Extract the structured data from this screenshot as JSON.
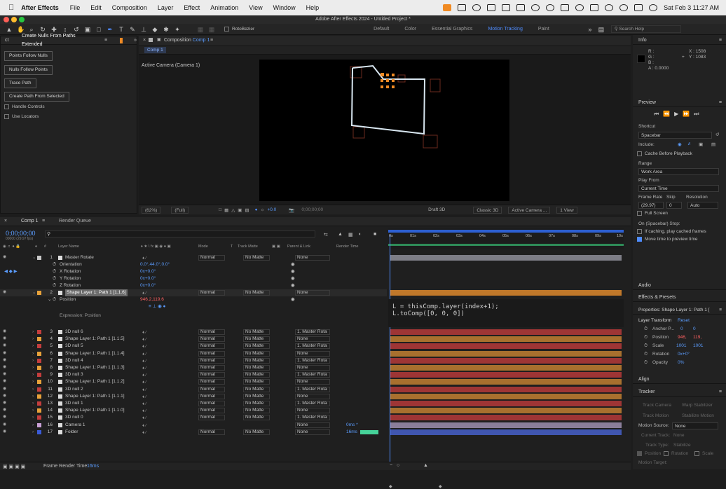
{
  "menubar": {
    "app_name": "After Effects",
    "menus": [
      "File",
      "Edit",
      "Composition",
      "Layer",
      "Effect",
      "Animation",
      "View",
      "Window",
      "Help"
    ],
    "clock": "Sat Feb 3  11:27 AM"
  },
  "window_title": "Adobe After Effects 2024 - Untitled Project *",
  "toolbar": {
    "rotobezier_label": "RotoBezier",
    "workspaces": [
      "Default",
      "Color",
      "Essential Graphics",
      "Motion Tracking",
      "Paint"
    ],
    "active_workspace": "Motion Tracking",
    "search_placeholder": "Search Help"
  },
  "scripts_panel": {
    "tab_left": "ct",
    "tab_title": "Create Nulls From Paths Extended",
    "buttons": [
      "Points Follow Nulls",
      "Nulls Follow Points",
      "Trace Path",
      "Create Path From Selected"
    ],
    "checkbox_handle": "Handle Controls",
    "checkbox_locators": "Use Locators"
  },
  "composition_panel": {
    "title": "Composition",
    "comp_name": "Comp 1",
    "sub_tab": "Comp 1",
    "camera_label": "Active Camera (Camera 1)",
    "zoom": "(62%)",
    "resolution": "(Full)",
    "exposure": "+0.0",
    "timecode": "0;00;00;00",
    "draft_3d": "Draft 3D",
    "renderer": "Classic 3D",
    "camera": "Active Camera ...",
    "views": "1 View"
  },
  "info_panel": {
    "title": "Info",
    "r": "R :",
    "g": "G :",
    "b": "B :",
    "a": "A :  0.0000",
    "x": "X : 1508",
    "y": "Y : 1083"
  },
  "preview_panel": {
    "title": "Preview",
    "shortcut_label": "Shortcut",
    "shortcut_value": "Spacebar",
    "include_label": "Include:",
    "cache_label": "Cache Before Playback",
    "range_label": "Range",
    "range_value": "Work Area",
    "play_from_label": "Play From",
    "play_from_value": "Current Time",
    "frame_rate_label": "Frame Rate",
    "skip_label": "Skip",
    "resolution_label": "Resolution",
    "frame_rate_value": "(29.97)",
    "skip_value": "0",
    "resolution_value": "Auto",
    "full_screen": "Full Screen",
    "on_stop": "On (Spacebar) Stop:",
    "if_caching": "If caching, play cached frames",
    "move_time": "Move time to preview time"
  },
  "audio_panel": {
    "title": "Audio"
  },
  "effects_panel": {
    "title": "Effects & Presets"
  },
  "properties_panel": {
    "title": "Properties: Shape Layer 1: Path 1 [",
    "section": "Layer Transform",
    "reset": "Reset",
    "rows": [
      {
        "label": "Anchor P...",
        "v1": "0",
        "v2": "0"
      },
      {
        "label": "Position",
        "v1": "946,",
        "v2": "119,"
      },
      {
        "label": "Scale",
        "v1": "1001",
        "v2": "1001"
      },
      {
        "label": "Rotation",
        "v1": "0x+0°",
        "v2": ""
      },
      {
        "label": "Opacity",
        "v1": "0%",
        "v2": ""
      }
    ]
  },
  "align_panel": {
    "title": "Align"
  },
  "tracker_panel": {
    "title": "Tracker",
    "track_camera": "Track Camera",
    "warp_stabilizer": "Warp Stabilizer",
    "track_motion": "Track Motion",
    "stabilize_motion": "Stabilize Motion",
    "motion_source_label": "Motion Source:",
    "motion_source_value": "None",
    "current_track": "Current Track:",
    "current_track_value": "None",
    "track_type": "Track Type:",
    "track_type_value": "Stabilize",
    "position": "Position",
    "rotation": "Rotation",
    "scale": "Scale",
    "motion_target": "Motion Target:"
  },
  "timeline": {
    "tab": "Comp 1",
    "render_queue": "Render Queue",
    "current_time": "0;00;00;00",
    "fps": "00000 (29.97 fps)",
    "headers": {
      "layer_name": "Layer Name",
      "mode": "Mode",
      "t": "T",
      "track_matte": "Track Matte",
      "parent": "Parent & Link",
      "render_time": "Render Time"
    },
    "ruler": [
      "0s",
      "01s",
      "02s",
      "03s",
      "04s",
      "05s",
      "06s",
      "07s",
      "08s",
      "09s",
      "10s"
    ],
    "props": {
      "orientation": {
        "label": "Orientation",
        "value": "0.0°,44.0°,0.0°"
      },
      "x_rotation": {
        "label": "X Rotation",
        "value": "0x+0.0°"
      },
      "y_rotation": {
        "label": "Y Rotation",
        "value": "0x+0.0°"
      },
      "z_rotation": {
        "label": "Z Rotation",
        "value": "0x+0.0°"
      },
      "position": {
        "label": "Position",
        "value": "946.2,119.6"
      },
      "expression_label": "Expression: Position",
      "expression_line1": "L = thisComp.layer(index+1);",
      "expression_line2": "L.toComp([0, 0, 0])"
    },
    "layers": [
      {
        "num": "1",
        "name": "Master Rotate",
        "color": "#c9c9c9",
        "mode": "Normal",
        "matte": "No Matte",
        "parent": "None",
        "bar": "#7d7d86"
      },
      {
        "num": "2",
        "name": "Shape Layer 1: Path 1 [1.1.6]",
        "color": "#e8a23a",
        "mode": "Normal",
        "matte": "No Matte",
        "parent": "None",
        "bar": "#c0782a"
      },
      {
        "num": "3",
        "name": "3D null 6",
        "color": "#c43d3d",
        "mode": "Normal",
        "matte": "No Matte",
        "parent": "1. Master Rota",
        "bar": "#9e3535"
      },
      {
        "num": "4",
        "name": "Shape Layer 1: Path 1 [1.1.5]",
        "color": "#e8a23a",
        "mode": "Normal",
        "matte": "No Matte",
        "parent": "None",
        "bar": "#a8702e"
      },
      {
        "num": "5",
        "name": "3D null 5",
        "color": "#c43d3d",
        "mode": "Normal",
        "matte": "No Matte",
        "parent": "1. Master Rota",
        "bar": "#9e3535"
      },
      {
        "num": "6",
        "name": "Shape Layer 1: Path 1 [1.1.4]",
        "color": "#e8a23a",
        "mode": "Normal",
        "matte": "No Matte",
        "parent": "None",
        "bar": "#a8702e"
      },
      {
        "num": "7",
        "name": "3D null 4",
        "color": "#c43d3d",
        "mode": "Normal",
        "matte": "No Matte",
        "parent": "1. Master Rota",
        "bar": "#9e3535"
      },
      {
        "num": "8",
        "name": "Shape Layer 1: Path 1 [1.1.3]",
        "color": "#e8a23a",
        "mode": "Normal",
        "matte": "No Matte",
        "parent": "None",
        "bar": "#a8702e"
      },
      {
        "num": "9",
        "name": "3D null 3",
        "color": "#c43d3d",
        "mode": "Normal",
        "matte": "No Matte",
        "parent": "1. Master Rota",
        "bar": "#9e3535"
      },
      {
        "num": "10",
        "name": "Shape Layer 1: Path 1 [1.1.2]",
        "color": "#e8a23a",
        "mode": "Normal",
        "matte": "No Matte",
        "parent": "None",
        "bar": "#a8702e"
      },
      {
        "num": "11",
        "name": "3D null 2",
        "color": "#c43d3d",
        "mode": "Normal",
        "matte": "No Matte",
        "parent": "1. Master Rota",
        "bar": "#9e3535"
      },
      {
        "num": "12",
        "name": "Shape Layer 1: Path 1 [1.1.1]",
        "color": "#e8a23a",
        "mode": "Normal",
        "matte": "No Matte",
        "parent": "None",
        "bar": "#a8702e"
      },
      {
        "num": "13",
        "name": "3D null 1",
        "color": "#c43d3d",
        "mode": "Normal",
        "matte": "No Matte",
        "parent": "1. Master Rota",
        "bar": "#9e3535"
      },
      {
        "num": "14",
        "name": "Shape Layer 1: Path 1 [1.1.0]",
        "color": "#e8a23a",
        "mode": "Normal",
        "matte": "No Matte",
        "parent": "None",
        "bar": "#a8702e"
      },
      {
        "num": "15",
        "name": "3D null 0",
        "color": "#c43d3d",
        "mode": "Normal",
        "matte": "No Matte",
        "parent": "1. Master Rota",
        "bar": "#9e3535"
      },
      {
        "num": "16",
        "name": "Camera 1",
        "color": "#c9a0d6",
        "mode": "",
        "matte": "",
        "parent": "None",
        "bar": "#8a7e9a",
        "render": "0ms *"
      },
      {
        "num": "17",
        "name": "Folder",
        "color": "#3a5bd9",
        "mode": "Normal",
        "matte": "No Matte",
        "parent": "None",
        "bar": "#4056b0",
        "render": "16ms"
      }
    ],
    "frame_render_label": "Frame Render Time",
    "frame_render_value": "16ms"
  }
}
